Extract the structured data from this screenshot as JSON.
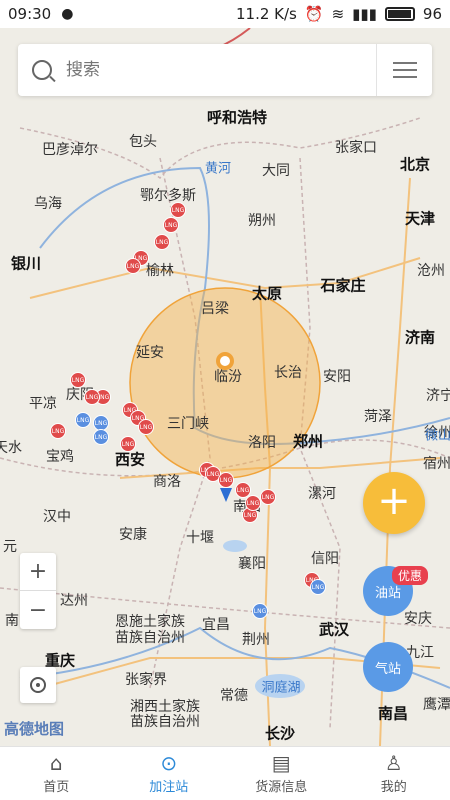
{
  "status_bar": {
    "time": "09:30",
    "net_speed": "11.2 K/s",
    "battery_level": 96,
    "battery_text": "96"
  },
  "search": {
    "placeholder": "搜索"
  },
  "map": {
    "cities": [
      {
        "name": "呼和浩特",
        "big": true
      },
      {
        "name": "包头"
      },
      {
        "name": "巴彦淖尔"
      },
      {
        "name": "乌海"
      },
      {
        "name": "鄂尔多斯"
      },
      {
        "name": "银川",
        "big": true
      },
      {
        "name": "榆林"
      },
      {
        "name": "大同"
      },
      {
        "name": "张家口"
      },
      {
        "name": "北京",
        "big": true
      },
      {
        "name": "天津",
        "big": true
      },
      {
        "name": "朔州"
      },
      {
        "name": "沧州"
      },
      {
        "name": "太原",
        "big": true
      },
      {
        "name": "石家庄",
        "big": true
      },
      {
        "name": "吕梁"
      },
      {
        "name": "济南",
        "big": true
      },
      {
        "name": "延安"
      },
      {
        "name": "临汾"
      },
      {
        "name": "长治"
      },
      {
        "name": "安阳"
      },
      {
        "name": "平凉"
      },
      {
        "name": "庆阳"
      },
      {
        "name": "济宁"
      },
      {
        "name": "菏泽"
      },
      {
        "name": "三门峡"
      },
      {
        "name": "天水"
      },
      {
        "name": "宝鸡"
      },
      {
        "name": "西安",
        "big": true
      },
      {
        "name": "洛阳"
      },
      {
        "name": "郑州",
        "big": true
      },
      {
        "name": "徐州"
      },
      {
        "name": "宿州"
      },
      {
        "name": "商洛"
      },
      {
        "name": "漯河"
      },
      {
        "name": "南阳"
      },
      {
        "name": "汉中"
      },
      {
        "name": "安康"
      },
      {
        "name": "十堰"
      },
      {
        "name": "元"
      },
      {
        "name": "信阳"
      },
      {
        "name": "襄阳"
      },
      {
        "name": "达州"
      },
      {
        "name": "恩施土家族"
      },
      {
        "name": "苗族自治州"
      },
      {
        "name": "宜昌"
      },
      {
        "name": "荆州"
      },
      {
        "name": "武汉",
        "big": true
      },
      {
        "name": "安庆"
      },
      {
        "name": "九江"
      },
      {
        "name": "重庆",
        "big": true
      },
      {
        "name": "张家界"
      },
      {
        "name": "湘西土家族"
      },
      {
        "name": "苗族自治州"
      },
      {
        "name": "常德"
      },
      {
        "name": "洞庭湖",
        "river": true
      },
      {
        "name": "长沙",
        "big": true
      },
      {
        "name": "南昌",
        "big": true
      },
      {
        "name": "鹰潭"
      },
      {
        "name": "黄河",
        "river": true
      },
      {
        "name": "微山",
        "river": true
      },
      {
        "name": "南"
      }
    ],
    "pin_label": "LNG",
    "zoom_in": "+",
    "zoom_out": "−",
    "logo": "高德地图"
  },
  "actions": {
    "add": "+",
    "fuel_station": "油站",
    "gas_station": "气站",
    "promo": "优惠"
  },
  "bottom_nav": [
    {
      "label": "首页",
      "icon": "⌂"
    },
    {
      "label": "加注站",
      "icon": "⊙",
      "active": true
    },
    {
      "label": "货源信息",
      "icon": "▤"
    },
    {
      "label": "我的",
      "icon": "♙"
    }
  ]
}
